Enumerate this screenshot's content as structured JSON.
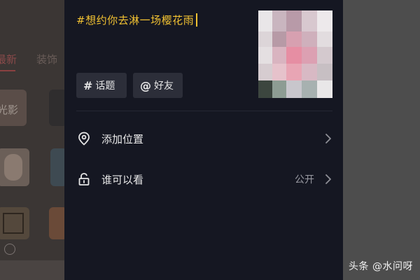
{
  "post": {
    "caption": "#想约你去淋一场樱花雨"
  },
  "tags": {
    "topic_label": "话题",
    "friend_label": "好友"
  },
  "options": {
    "location_label": "添加位置",
    "visibility_label": "谁可以看",
    "visibility_value": "公开"
  },
  "background": {
    "tab_latest": "最新",
    "tab_decor": "装饰",
    "card_label": "光影"
  },
  "watermark": "头条 @水问呀",
  "colors": {
    "panel_bg": "#151722",
    "caption_yellow": "#f2c232",
    "button_bg": "#2c2e39"
  },
  "icons": {
    "topic": "hash-icon",
    "friend": "at-icon",
    "location": "location-pin-icon",
    "visibility": "unlock-icon",
    "arrow": "chevron-right-icon"
  }
}
